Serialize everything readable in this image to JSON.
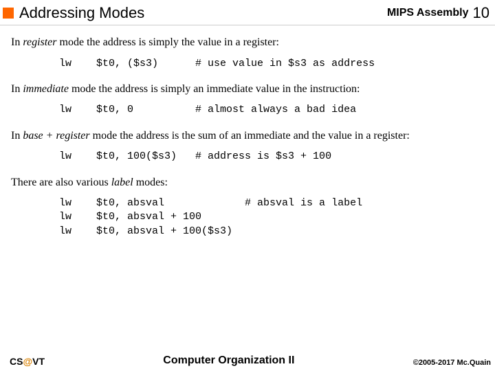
{
  "header": {
    "title": "Addressing Modes",
    "subject": "MIPS Assembly",
    "page": "10"
  },
  "section1": {
    "pre": "In ",
    "mode": "register",
    "post": " mode the address is simply the value in a register:",
    "code": "lw    $t0, ($s3)      # use value in $s3 as address"
  },
  "section2": {
    "pre": "In ",
    "mode": "immediate",
    "post": " mode the address is simply an immediate value in the instruction:",
    "code": "lw    $t0, 0          # almost always a bad idea"
  },
  "section3": {
    "pre": "In ",
    "mode": "base + register",
    "post": " mode the address is the sum of an immediate and the value in a register:",
    "code": "lw    $t0, 100($s3)   # address is $s3 + 100"
  },
  "section4": {
    "pre": "There are also various ",
    "mode": "label",
    "post": " modes:",
    "code": "lw    $t0, absval             # absval is a label\nlw    $t0, absval + 100\nlw    $t0, absval + 100($s3)"
  },
  "footer": {
    "cs": "CS",
    "at": "@",
    "vt": "VT",
    "course": "Computer Organization II",
    "copyright": "©2005-2017 Mc.Quain"
  }
}
